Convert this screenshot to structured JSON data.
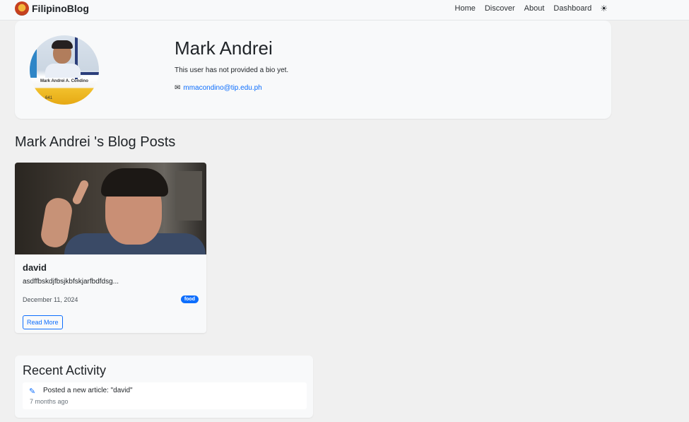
{
  "navbar": {
    "brand": "FilipinoBlog",
    "links": [
      "Home",
      "Discover",
      "About",
      "Dashboard"
    ],
    "theme_icon": "sun-icon"
  },
  "profile": {
    "name": "Mark Andrei",
    "bio": "This user has not provided a bio yet.",
    "email": "mmacondino@tip.edu.ph",
    "avatar_label": "Mark Andrei A. Condino",
    "avatar_id": "641"
  },
  "posts_section": {
    "title": "Mark Andrei 's Blog Posts",
    "posts": [
      {
        "title": "david",
        "excerpt": "asdffbskdjfbsjkbfskjarfbdfdsg...",
        "date": "December 11, 2024",
        "tag": "food",
        "button": "Read More"
      }
    ]
  },
  "activity": {
    "title": "Recent Activity",
    "items": [
      {
        "icon": "pencil-icon",
        "text": "Posted a new article: \"david\"",
        "time": "7 months ago"
      }
    ]
  },
  "colors": {
    "accent": "#0d6efd",
    "background": "#f0f0f0",
    "card": "#f8f9fa"
  }
}
